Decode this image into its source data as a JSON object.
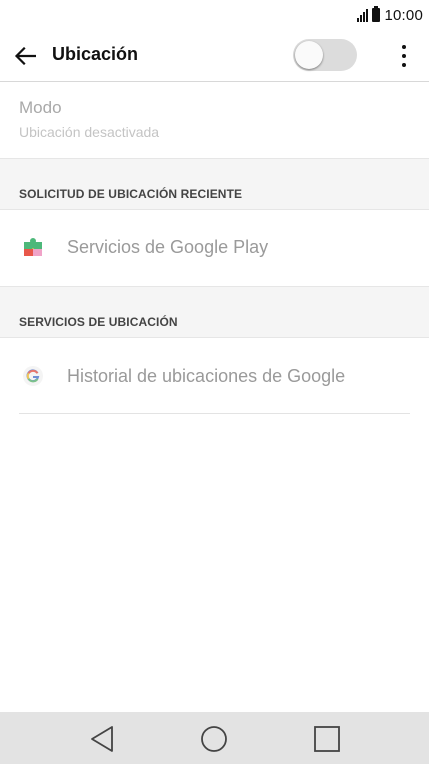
{
  "status_bar": {
    "time": "10:00"
  },
  "app_bar": {
    "title": "Ubicación",
    "switch_state": "off"
  },
  "mode": {
    "title": "Modo",
    "subtitle": "Ubicación desactivada"
  },
  "sections": [
    {
      "header": "SOLICITUD DE UBICACIÓN RECIENTE",
      "items": [
        {
          "label": "Servicios de Google Play",
          "icon": "puzzle-icon"
        }
      ]
    },
    {
      "header": "SERVICIOS DE UBICACIÓN",
      "items": [
        {
          "label": "Historial de ubicaciones de Google",
          "icon": "google-g-icon"
        }
      ]
    }
  ],
  "nav_bar": {
    "buttons": [
      "back-icon",
      "home-icon",
      "recents-icon"
    ]
  },
  "colors": {
    "accent_puzzle_green": "#4db87a",
    "accent_puzzle_yellow": "#f5c542",
    "accent_puzzle_red": "#e8574a",
    "switch_track": "#dcdcdc"
  }
}
